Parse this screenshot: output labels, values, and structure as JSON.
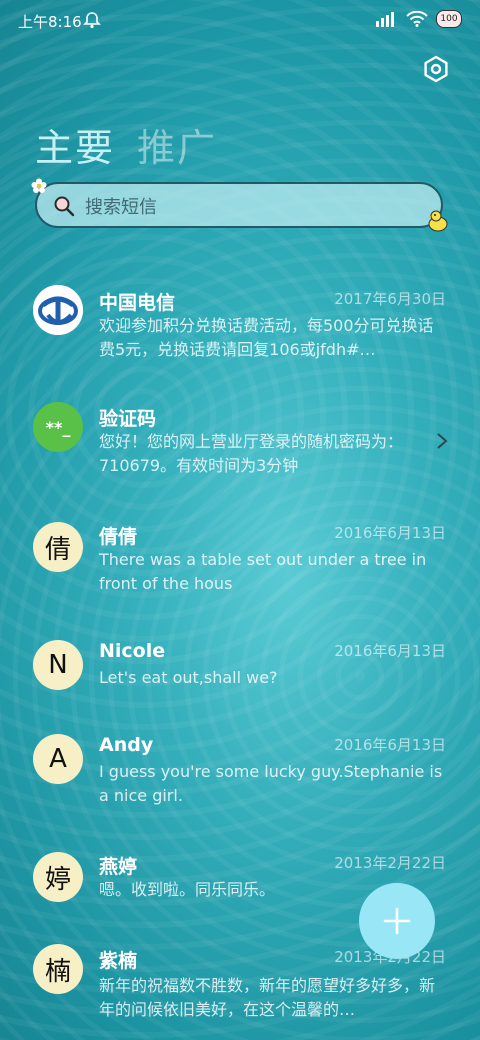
{
  "status": {
    "time": "上午8:16",
    "battery": "100"
  },
  "tabs": [
    {
      "label": "主要"
    },
    {
      "label": "推广"
    }
  ],
  "search": {
    "placeholder": "搜索短信"
  },
  "conversations": [
    {
      "name": "中国电信",
      "date": "2017年6月30日",
      "preview": "欢迎参加积分兑换话费活动，每500分可兑换话费5元，兑换话费请回复106或jfdh#…",
      "avatar": ""
    },
    {
      "name": "验证码",
      "date": "",
      "preview": "您好！您的网上营业厅登录的随机密码为：710679。有效时间为3分钟",
      "avatar": "**_"
    },
    {
      "name": "倩倩",
      "date": "2016年6月13日",
      "preview": "There was a table set out under a tree in front of the hous",
      "avatar": "倩"
    },
    {
      "name": "Nicole",
      "date": "2016年6月13日",
      "preview": "Let's eat out,shall we?",
      "avatar": "N"
    },
    {
      "name": "Andy",
      "date": "2016年6月13日",
      "preview": "I guess you're some lucky guy.Stephanie is a nice girl.",
      "avatar": "A"
    },
    {
      "name": "燕婷",
      "date": "2013年2月22日",
      "preview": "嗯。收到啦。同乐同乐。",
      "avatar": "婷"
    },
    {
      "name": "紫楠",
      "date": "2013年2月22日",
      "preview": "新年的祝福数不胜数，新年的愿望好多好多，新年的问候依旧美好，在这个温馨的…",
      "avatar": "楠"
    }
  ],
  "colors": {
    "accent": "#99e7f6",
    "verify_avatar": "#59c148",
    "contact_avatar": "#f7efc6",
    "telecom_blue": "#1f5fae"
  }
}
